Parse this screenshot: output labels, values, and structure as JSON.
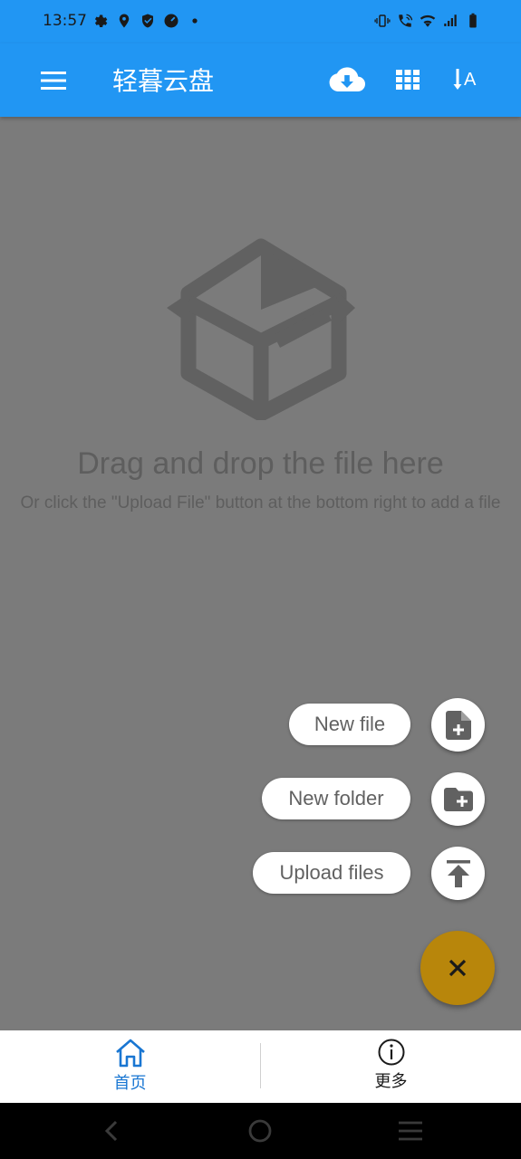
{
  "status_bar": {
    "time": "13:57",
    "left_icons": [
      "gear-icon",
      "location-icon",
      "shield-icon",
      "speed-icon",
      "dot-icon"
    ],
    "right_icons": [
      "vibrate-icon",
      "wifi-call-icon",
      "wifi-icon",
      "signal-icon",
      "battery-icon"
    ]
  },
  "app_bar": {
    "title": "轻暮云盘",
    "background": "#2196f3",
    "actions": [
      "cloud-download-icon",
      "grid-view-icon",
      "sort-alpha-icon"
    ]
  },
  "empty_state": {
    "title": "Drag and drop the file here",
    "subtitle": "Or click the \"Upload File\" button at the bottom right to add a file"
  },
  "fab_menu": {
    "items": [
      {
        "label": "New file",
        "icon": "new-file-icon"
      },
      {
        "label": "New folder",
        "icon": "new-folder-icon"
      },
      {
        "label": "Upload files",
        "icon": "upload-icon"
      }
    ],
    "main_icon": "close-icon",
    "main_color": "#b8860b"
  },
  "bottom_nav": {
    "items": [
      {
        "label": "首页",
        "icon": "home-icon",
        "active": true
      },
      {
        "label": "更多",
        "icon": "info-icon",
        "active": false
      }
    ],
    "active_color": "#1976d2"
  }
}
